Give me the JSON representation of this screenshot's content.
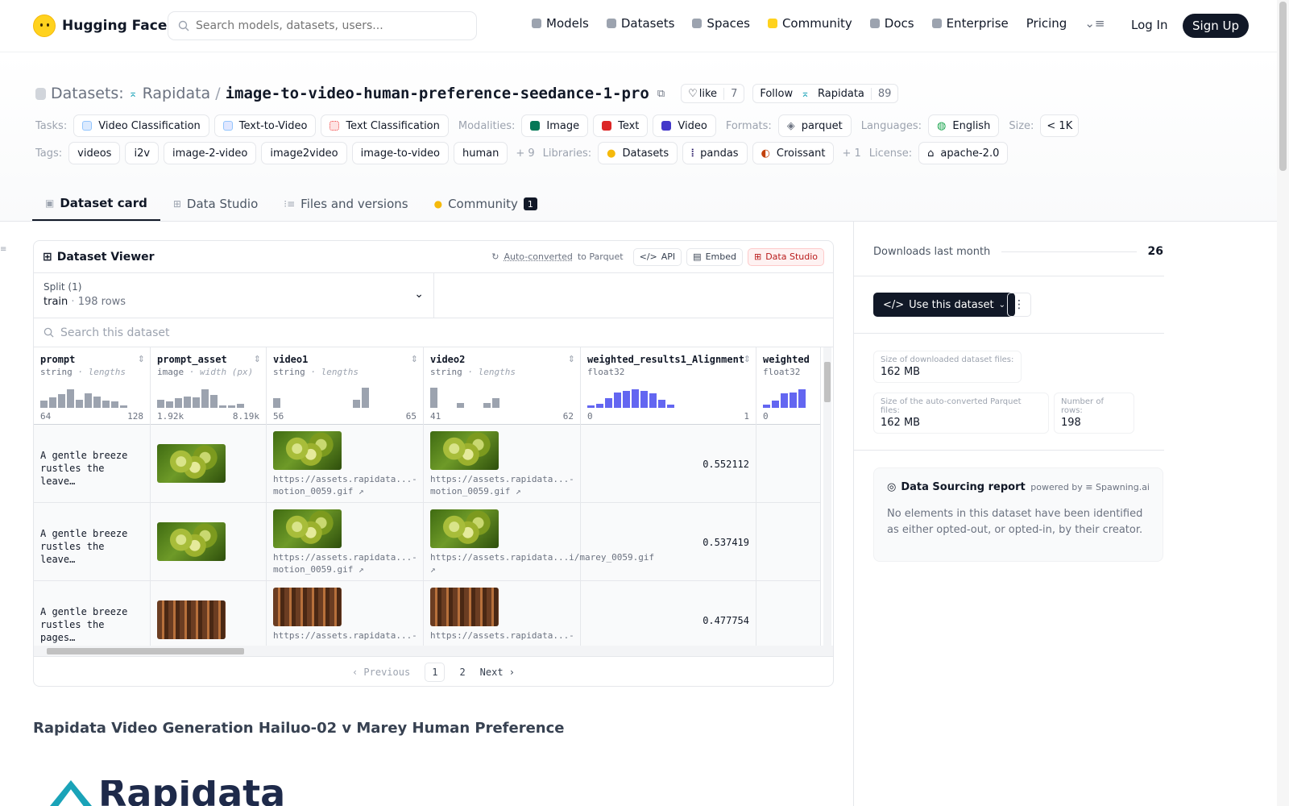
{
  "header": {
    "brand": "Hugging Face",
    "search_placeholder": "Search models, datasets, users...",
    "nav": [
      {
        "label": "Models",
        "icon": "cube-icon",
        "color": "#9ca3af"
      },
      {
        "label": "Datasets",
        "icon": "database-icon",
        "color": "#9ca3af"
      },
      {
        "label": "Spaces",
        "icon": "grid-icon",
        "color": "#9ca3af"
      },
      {
        "label": "Community",
        "icon": "hf-emoji-icon",
        "color": "#FFD21E"
      },
      {
        "label": "Docs",
        "icon": "book-icon",
        "color": "#9ca3af"
      },
      {
        "label": "Enterprise",
        "icon": "enterprise-icon",
        "color": "#9ca3af"
      },
      {
        "label": "Pricing"
      }
    ],
    "login": "Log In",
    "signup": "Sign Up"
  },
  "repo": {
    "type_label": "Datasets:",
    "owner": "Rapidata",
    "separator": "/",
    "name": "image-to-video-human-preference-seedance-1-pro",
    "like_label": "like",
    "like_count": "7",
    "follow_label": "Follow",
    "follow_owner": "Rapidata",
    "follow_count": "89"
  },
  "meta": {
    "tasks_label": "Tasks:",
    "tasks": [
      "Video Classification",
      "Text-to-Video",
      "Text Classification"
    ],
    "modalities_label": "Modalities:",
    "modalities": [
      "Image",
      "Text",
      "Video"
    ],
    "formats_label": "Formats:",
    "formats": [
      "parquet"
    ],
    "languages_label": "Languages:",
    "languages": [
      "English"
    ],
    "size_label": "Size:",
    "size": "< 1K",
    "tags_label": "Tags:",
    "tags": [
      "videos",
      "i2v",
      "image-2-video",
      "image2video",
      "image-to-video",
      "human"
    ],
    "tags_more": "+ 9",
    "libraries_label": "Libraries:",
    "libraries": [
      "Datasets",
      "pandas",
      "Croissant"
    ],
    "libraries_more": "+ 1",
    "license_label": "License:",
    "license": "apache-2.0"
  },
  "tabs": [
    {
      "label": "Dataset card",
      "active": true
    },
    {
      "label": "Data Studio"
    },
    {
      "label": "Files and versions"
    },
    {
      "label": "Community",
      "badge": "1"
    }
  ],
  "viewer": {
    "title": "Dataset Viewer",
    "autoconv_link": "Auto-converted",
    "autoconv_rest": "to Parquet",
    "api": "API",
    "embed": "Embed",
    "studio": "Data Studio",
    "split_label": "Split (1)",
    "split_value": "train",
    "split_rows": "198 rows",
    "search_placeholder": "Search this dataset",
    "columns": [
      {
        "name": "prompt",
        "type": "string",
        "sub": "lengths",
        "min": "64",
        "max": "128",
        "hist": [
          0.35,
          0.5,
          0.65,
          0.9,
          0.4,
          0.7,
          0.55,
          0.35,
          0.3,
          0.05
        ],
        "color": "#9ca3af"
      },
      {
        "name": "prompt_asset",
        "type": "image",
        "sub": "width (px)",
        "min": "1.92k",
        "max": "8.19k",
        "hist": [
          0.4,
          0.3,
          0.45,
          0.55,
          0.5,
          0.9,
          0.6,
          0.1,
          0.1,
          0.2
        ],
        "color": "#9ca3af"
      },
      {
        "name": "video1",
        "type": "string",
        "sub": "lengths",
        "min": "56",
        "max": "65",
        "hist": [
          0.45,
          0,
          0,
          0,
          0,
          0,
          0,
          0,
          0,
          0.4,
          0.95
        ],
        "color": "#9ca3af"
      },
      {
        "name": "video2",
        "type": "string",
        "sub": "lengths",
        "min": "41",
        "max": "62",
        "hist": [
          0.95,
          0,
          0,
          0.25,
          0,
          0,
          0.25,
          0.45
        ],
        "color": "#9ca3af"
      },
      {
        "name": "weighted_results1_Alignment",
        "type": "float32",
        "sub": "",
        "min": "0",
        "max": "1",
        "hist": [
          0.05,
          0.2,
          0.45,
          0.75,
          0.8,
          0.9,
          0.8,
          0.7,
          0.4,
          0.15
        ],
        "color": "#6366f1"
      },
      {
        "name": "weighted",
        "type": "float32",
        "sub": "",
        "min": "0",
        "max": "",
        "hist": [
          0.15,
          0.35,
          0.7,
          0.75,
          0.9
        ],
        "color": "#6366f1"
      }
    ],
    "rows": [
      {
        "prompt": "A gentle breeze rustles the leave…",
        "thumb": "grape",
        "v1_url": "https://assets.rapidata...-motion_0059.gif",
        "v2_url": "https://assets.rapidata...-motion_0059.gif",
        "score": "0.552112"
      },
      {
        "prompt": "A gentle breeze rustles the leave…",
        "thumb": "grape",
        "v1_url": "https://assets.rapidata...-motion_0059.gif",
        "v2_url": "https://assets.rapidata...i/marey_0059.gif",
        "score": "0.537419"
      },
      {
        "prompt": "A gentle breeze rustles the pages…",
        "thumb": "lib",
        "v1_url": "https://assets.rapidata...-",
        "v2_url": "https://assets.rapidata...-",
        "score": "0.477754"
      }
    ],
    "pager": {
      "prev": "Previous",
      "pages": [
        "1",
        "2"
      ],
      "current": "1",
      "next": "Next"
    }
  },
  "sidebar": {
    "downloads_label": "Downloads last month",
    "downloads": "26",
    "use_dataset": "Use this dataset",
    "stats": [
      {
        "label": "Size of downloaded dataset files:",
        "value": "162 MB"
      },
      {
        "label": "Size of the auto-converted Parquet files:",
        "value": "162 MB"
      },
      {
        "label": "Number of rows:",
        "value": "198"
      }
    ],
    "report_title": "Data Sourcing report",
    "report_powered": "powered by",
    "report_vendor": "Spawning.ai",
    "report_text": "No elements in this dataset have been identified as either opted-out, or opted-in, by their creator."
  },
  "card": {
    "title": "Rapidata Video Generation Hailuo-02 v Marey Human Preference",
    "logo_text": "Rapidata"
  }
}
